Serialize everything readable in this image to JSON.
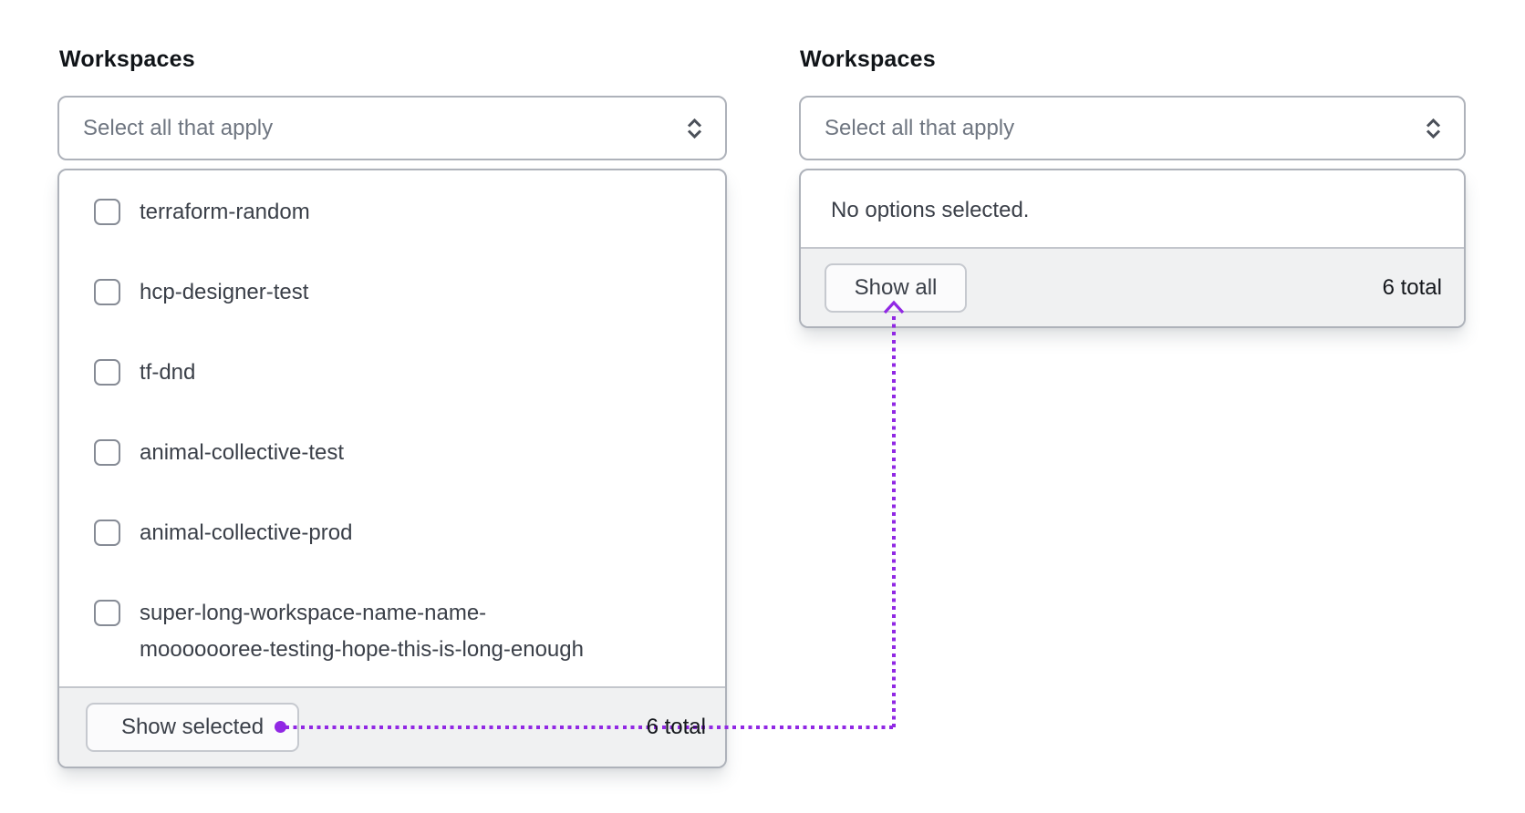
{
  "colors": {
    "accent_purple": "#9128e4",
    "card_border": "#aeb2ba",
    "footer_background": "#f0f1f2",
    "divider": "#c3c6cc",
    "text_primary": "#101418",
    "text_option": "#3a3f48",
    "text_placeholder": "#6f7681"
  },
  "left_panel": {
    "label": "Workspaces",
    "select": {
      "placeholder": "Select all that apply",
      "icon": "chevron-up-down-icon"
    },
    "options": [
      {
        "label": "terraform-random",
        "checked": false
      },
      {
        "label": "hcp-designer-test",
        "checked": false
      },
      {
        "label": "tf-dnd",
        "checked": false
      },
      {
        "label": "animal-collective-test",
        "checked": false
      },
      {
        "label": "animal-collective-prod",
        "checked": false
      },
      {
        "label": "super-long-workspace-name-name-mooooooree-testing-hope-this-is-long-enough",
        "checked": false,
        "lines": [
          "super-long-workspace-name-name-",
          "mooooooree-testing-hope-this-is-long-enough"
        ]
      }
    ],
    "footer": {
      "button_label": "Show selected",
      "total_label": "6 total"
    }
  },
  "right_panel": {
    "label": "Workspaces",
    "select": {
      "placeholder": "Select all that apply",
      "icon": "chevron-up-down-icon"
    },
    "empty_message": "No options selected.",
    "footer": {
      "button_label": "Show all",
      "total_label": "6 total"
    }
  },
  "annotation": {
    "type": "connector",
    "style": "dotted",
    "color": "#9128e4",
    "from": "show-selected-button",
    "to": "show-all-button"
  }
}
